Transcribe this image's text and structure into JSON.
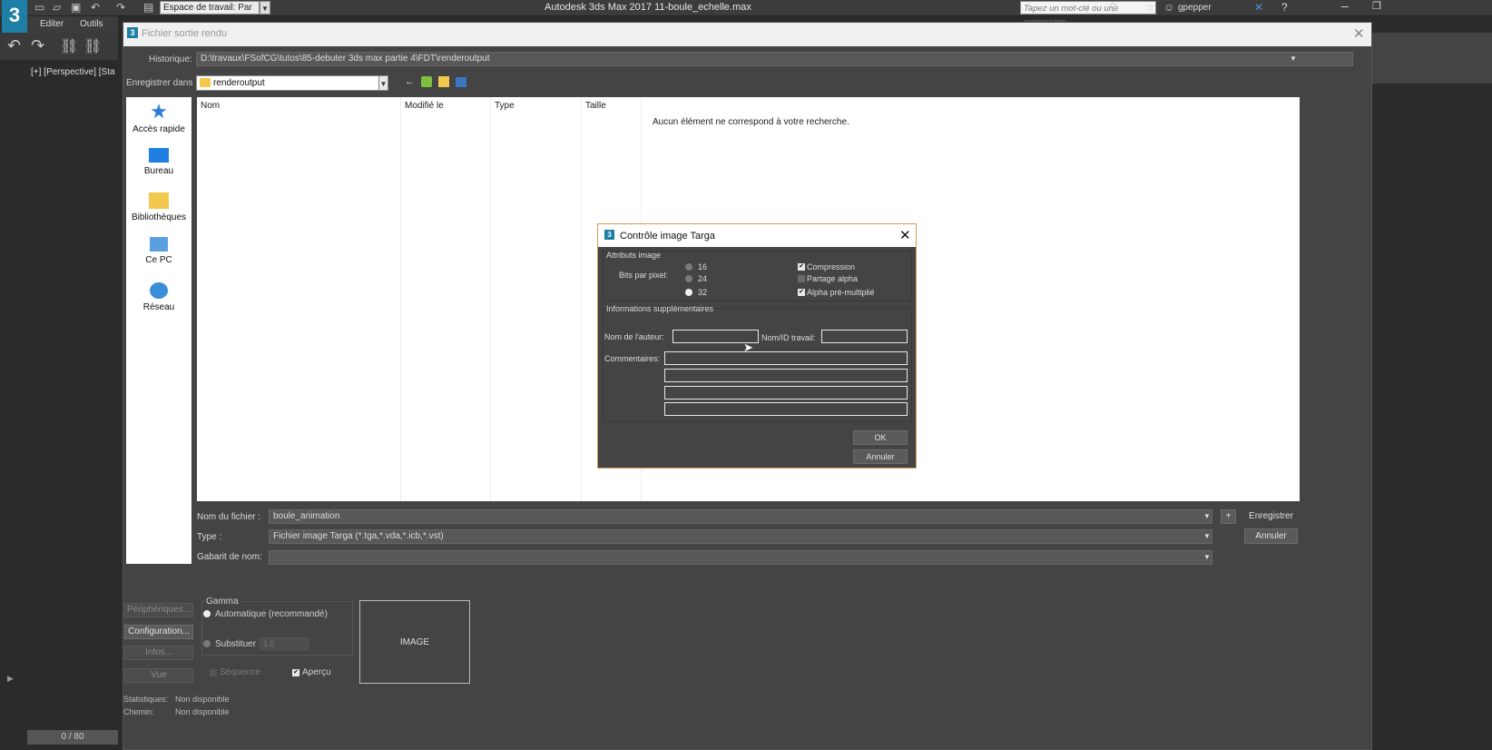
{
  "max": {
    "workspace_label": "Espace de travail: Par",
    "app_title": "Autodesk 3ds Max 2017    11-boule_echelle.max",
    "search_placeholder": "Tapez un mot-clé ou une expression",
    "user": "gpepper",
    "menu": [
      "Editer",
      "Outils"
    ],
    "viewport_label": "[+] [Perspective] [Sta",
    "timeline": "0 / 80",
    "logo": "3"
  },
  "file_dialog": {
    "title": "Fichier sortie rendu",
    "history_label": "Historique:",
    "history_value": "D:\\travaux\\FSofCG\\tutos\\85-debuter 3ds max partie 4\\FDT\\renderoutput",
    "save_in_label": "Enregistrer dans :",
    "save_in_value": "renderoutput",
    "places": [
      "Accès rapide",
      "Bureau",
      "Bibliothèques",
      "Ce PC",
      "Réseau"
    ],
    "columns": [
      "Nom",
      "Modifié le",
      "Type",
      "Taille"
    ],
    "empty_message": "Aucun élément ne correspond à votre recherche.",
    "filename_label": "Nom du fichier :",
    "filename_value": "boule_animation",
    "type_label": "Type :",
    "type_value": "Fichier image Targa (*.tga,*.vda,*.icb,*.vst)",
    "template_label": "Gabarit de nom:",
    "template_value": "",
    "save_button": "Enregistrer",
    "cancel_button": "Annuler",
    "plus_button": "+",
    "left_buttons": [
      "Périphériques...",
      "Configuration...",
      "Infos...",
      "Vue"
    ],
    "gamma_title": "Gamma",
    "gamma_auto": "Automatique (recommandé)",
    "gamma_override": "Substituer",
    "gamma_value": "1.0",
    "sequence": "Séquence",
    "preview": "Aperçu",
    "image_label": "IMAGE",
    "stats_label": "Statistiques:",
    "stats_value": "Non disponible",
    "path_label": "Chemin:",
    "path_value": "Non disponible"
  },
  "targa_dialog": {
    "title": "Contrôle image Targa",
    "attributes_title": "Attributs image",
    "bits_label": "Bits par pixel:",
    "bits_options": [
      "16",
      "24",
      "32"
    ],
    "bits_selected": "32",
    "compression": "Compression",
    "alpha_split": "Partage alpha",
    "premultiplied": "Alpha pré-multiplié",
    "info_title": "Informations supplémentaires",
    "author_label": "Nom de l'auteur:",
    "job_label": "Nom/ID travail:",
    "comments_label": "Commentaires:",
    "ok_button": "OK",
    "cancel_button": "Annuler"
  }
}
